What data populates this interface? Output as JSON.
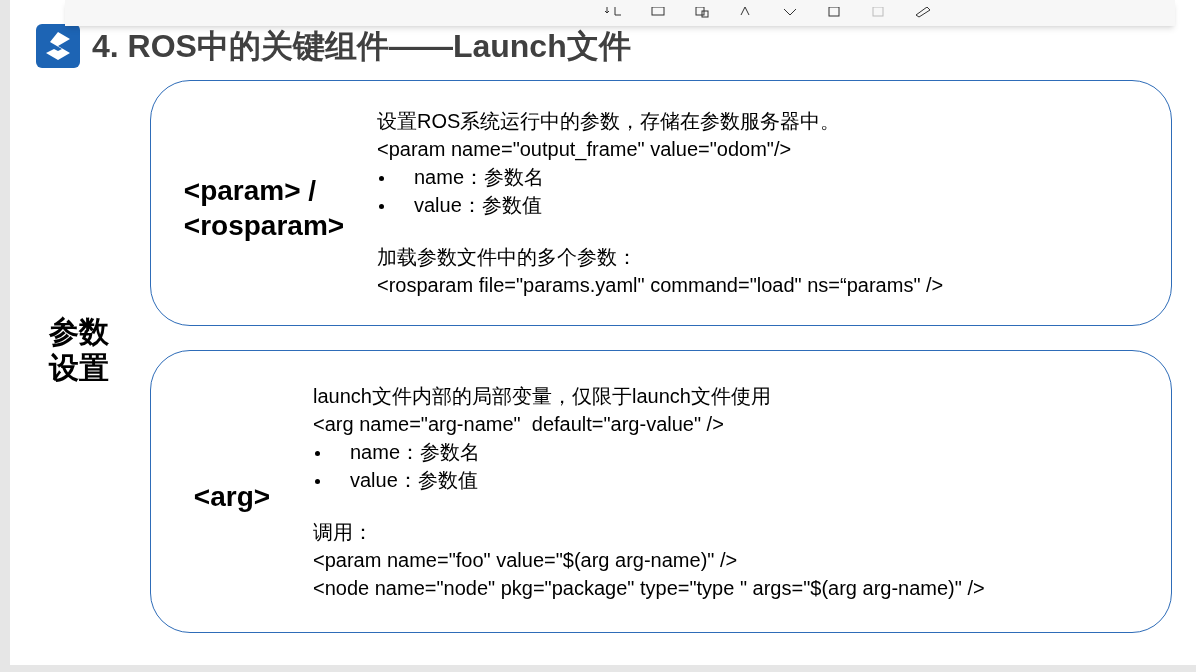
{
  "title": "4. ROS中的关键组件——Launch文件",
  "section_label": "参数设置",
  "cards": [
    {
      "tag": "<param> /\n<rosparam>",
      "lines": [
        {
          "kind": "text",
          "text": "设置ROS系统运行中的参数，存储在参数服务器中。"
        },
        {
          "kind": "text",
          "text": "<param name=\"output_frame\" value=\"odom\"/>"
        },
        {
          "kind": "bullet",
          "text": "name：参数名"
        },
        {
          "kind": "bullet",
          "text": "value：参数值"
        },
        {
          "kind": "blank"
        },
        {
          "kind": "text",
          "text": "加载参数文件中的多个参数："
        },
        {
          "kind": "text",
          "text": "<rosparam file=\"params.yaml\" command=\"load\" ns=“params\" />"
        }
      ]
    },
    {
      "tag": "<arg>",
      "lines": [
        {
          "kind": "text",
          "text": "launch文件内部的局部变量，仅限于launch文件使用"
        },
        {
          "kind": "text",
          "text": "<arg name=\"arg-name\"  default=\"arg-value\" />"
        },
        {
          "kind": "bullet",
          "text": "name：参数名"
        },
        {
          "kind": "bullet",
          "text": "value：参数值"
        },
        {
          "kind": "blank"
        },
        {
          "kind": "text",
          "text": "调用："
        },
        {
          "kind": "text",
          "text": "<param name=\"foo\" value=\"$(arg arg-name)\" />"
        },
        {
          "kind": "text",
          "text": "<node name=\"node\" pkg=\"package\" type=\"type \" args=\"$(arg arg-name)\" />"
        }
      ]
    }
  ]
}
